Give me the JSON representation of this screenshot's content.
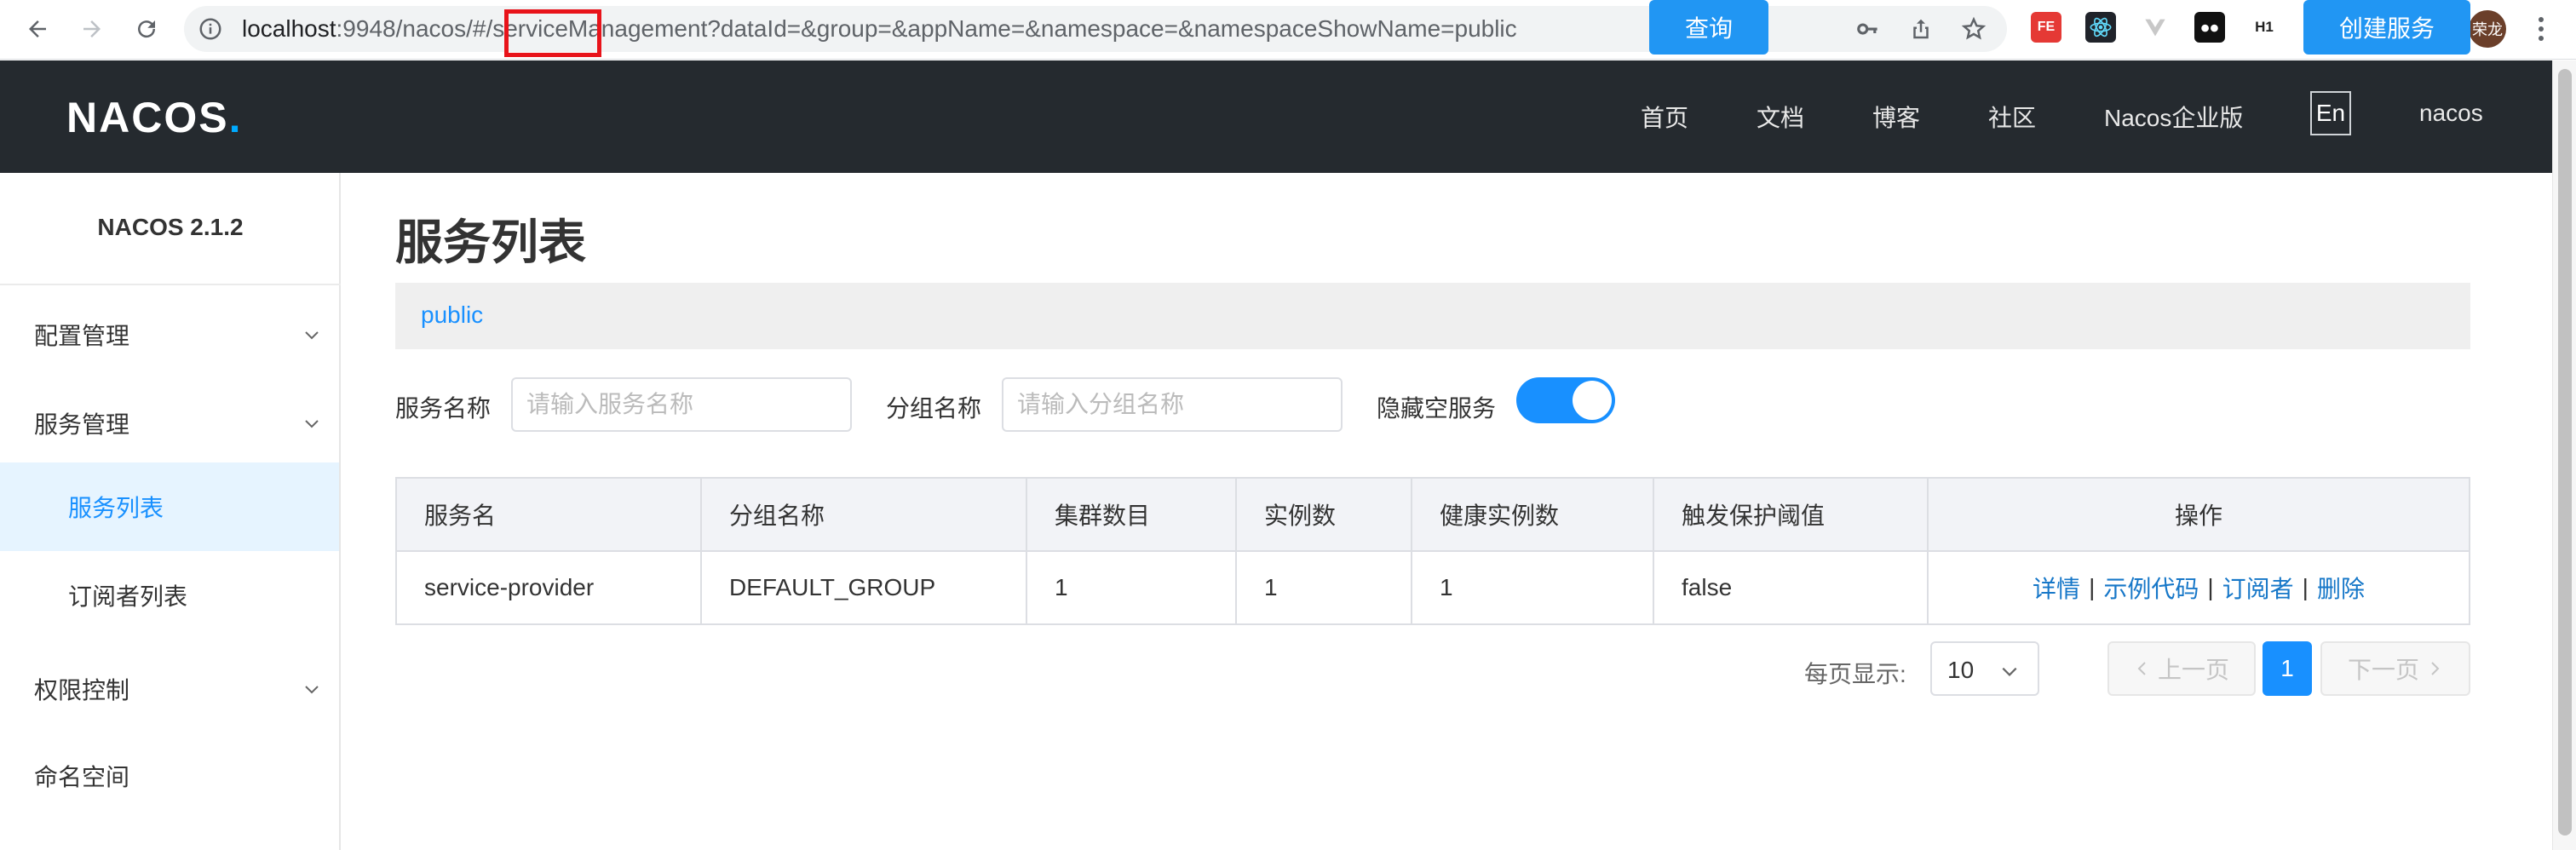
{
  "browser": {
    "url_host": "localhost",
    "url_port": ":9948",
    "url_path": "/nacos/#/serviceManagement?dataId=&group=&appName=&namespace=&namespaceShowName=public",
    "avatar_text": "荣龙",
    "ext_fe": "FE",
    "ext_h1": "H1"
  },
  "header": {
    "logo": "NACOS",
    "logo_dot": ".",
    "nav": [
      "首页",
      "文档",
      "博客",
      "社区",
      "Nacos企业版"
    ],
    "lang": "En",
    "user": "nacos"
  },
  "sidebar": {
    "version": "NACOS 2.1.2",
    "items": [
      {
        "label": "配置管理"
      },
      {
        "label": "服务管理"
      },
      {
        "label": "服务列表"
      },
      {
        "label": "订阅者列表"
      },
      {
        "label": "权限控制"
      },
      {
        "label": "命名空间"
      }
    ]
  },
  "main": {
    "title": "服务列表",
    "namespace": "public",
    "filters": {
      "service_name_label": "服务名称",
      "service_name_placeholder": "请输入服务名称",
      "group_name_label": "分组名称",
      "group_name_placeholder": "请输入分组名称",
      "hide_empty_label": "隐藏空服务",
      "hide_empty_on": true,
      "query_button": "查询",
      "create_button": "创建服务"
    },
    "table": {
      "columns": [
        "服务名",
        "分组名称",
        "集群数目",
        "实例数",
        "健康实例数",
        "触发保护阈值",
        "操作"
      ],
      "rows": [
        {
          "service": "service-provider",
          "group": "DEFAULT_GROUP",
          "clusters": "1",
          "instances": "1",
          "healthy": "1",
          "threshold": "false"
        }
      ],
      "actions": [
        "详情",
        "示例代码",
        "订阅者",
        "删除"
      ],
      "action_sep": "|"
    },
    "pagination": {
      "per_page_label": "每页显示:",
      "per_page_value": "10",
      "prev": "上一页",
      "current": "1",
      "next": "下一页"
    }
  },
  "colors": {
    "header_bg": "#252a2f",
    "accent": "#1890ff",
    "highlight_box": "#e8131a"
  }
}
